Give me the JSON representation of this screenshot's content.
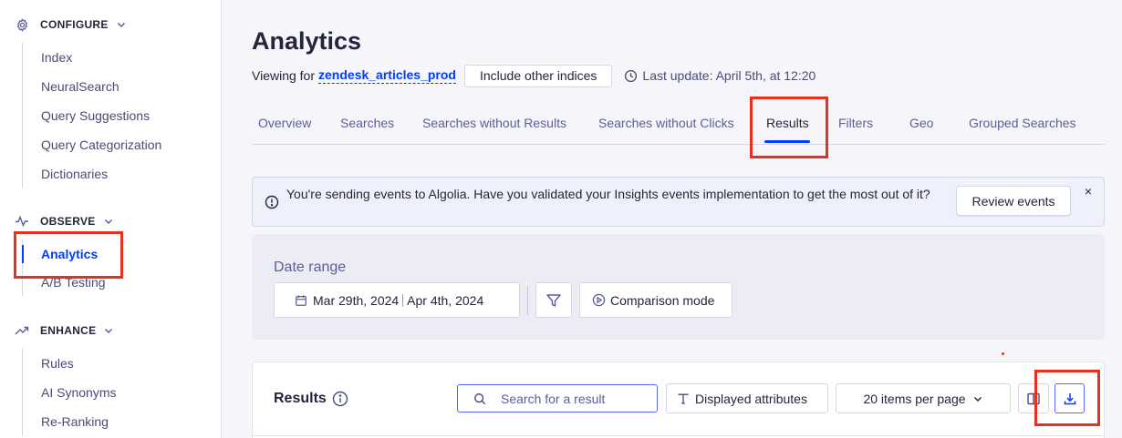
{
  "sidebar": {
    "configure": {
      "heading": "CONFIGURE",
      "items": [
        "Index",
        "NeuralSearch",
        "Query Suggestions",
        "Query Categorization",
        "Dictionaries"
      ]
    },
    "observe": {
      "heading": "OBSERVE",
      "items": [
        "Analytics",
        "A/B Testing"
      ]
    },
    "enhance": {
      "heading": "ENHANCE",
      "items": [
        "Rules",
        "AI Synonyms",
        "Re-Ranking"
      ]
    }
  },
  "header": {
    "title": "Analytics",
    "viewing_prefix": "Viewing for",
    "index_name": "zendesk_articles_prod",
    "include_button": "Include other indices",
    "last_update": "Last update: April 5th, at 12:20"
  },
  "tabs": [
    "Overview",
    "Searches",
    "Searches without Results",
    "Searches without Clicks",
    "Results",
    "Filters",
    "Geo",
    "Grouped Searches"
  ],
  "alert": {
    "message": "You're sending events to Algolia. Have you validated your Insights events implementation to get the most out of it?",
    "review_button": "Review events",
    "close": "×"
  },
  "date_range": {
    "label": "Date range",
    "start": "Mar 29th, 2024",
    "end": "Apr 4th, 2024",
    "comparison_button": "Comparison mode"
  },
  "results": {
    "title": "Results",
    "search_placeholder": "Search for a result",
    "attributes_button": "Displayed attributes",
    "per_page": "20 items per page"
  },
  "colors": {
    "accent": "#003dff",
    "highlight": "#e8301c"
  }
}
